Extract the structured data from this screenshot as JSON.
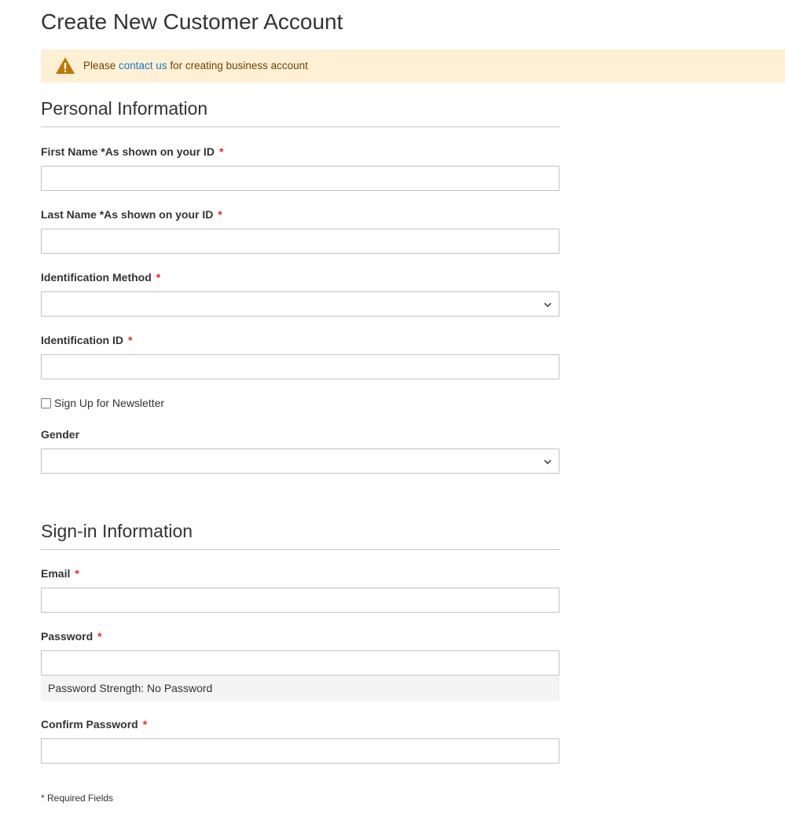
{
  "page": {
    "title": "Create New Customer Account"
  },
  "notice": {
    "icon": "warning-triangle-icon",
    "icon_color": "#c07600",
    "background_color": "#fdf0d5",
    "text_before": "Please ",
    "link_text": "contact us",
    "text_after": " for creating business account"
  },
  "personal": {
    "heading": "Personal Information",
    "first_name": {
      "label": "First Name *As shown on your ID",
      "required_mark": "*",
      "value": ""
    },
    "last_name": {
      "label": "Last Name *As shown on your ID",
      "required_mark": "*",
      "value": ""
    },
    "identification_method": {
      "label": "Identification Method",
      "required_mark": "*",
      "selected": ""
    },
    "identification_id": {
      "label": "Identification ID",
      "required_mark": "*",
      "value": ""
    },
    "newsletter": {
      "label": "Sign Up for Newsletter",
      "checked": false
    },
    "gender": {
      "label": "Gender",
      "selected": ""
    }
  },
  "signin": {
    "heading": "Sign-in Information",
    "email": {
      "label": "Email",
      "required_mark": "*",
      "value": ""
    },
    "password": {
      "label": "Password",
      "required_mark": "*",
      "value": "",
      "strength_text": "Password Strength: No Password"
    },
    "confirm_password": {
      "label": "Confirm Password",
      "required_mark": "*",
      "value": ""
    }
  },
  "footer": {
    "required_note": "* Required Fields"
  },
  "colors": {
    "required_asterisk": "#e02b27",
    "link": "#1979c3",
    "notice_text": "#6f4400",
    "input_border": "#c2c2c2",
    "strength_bg": "#f4f4f4"
  }
}
